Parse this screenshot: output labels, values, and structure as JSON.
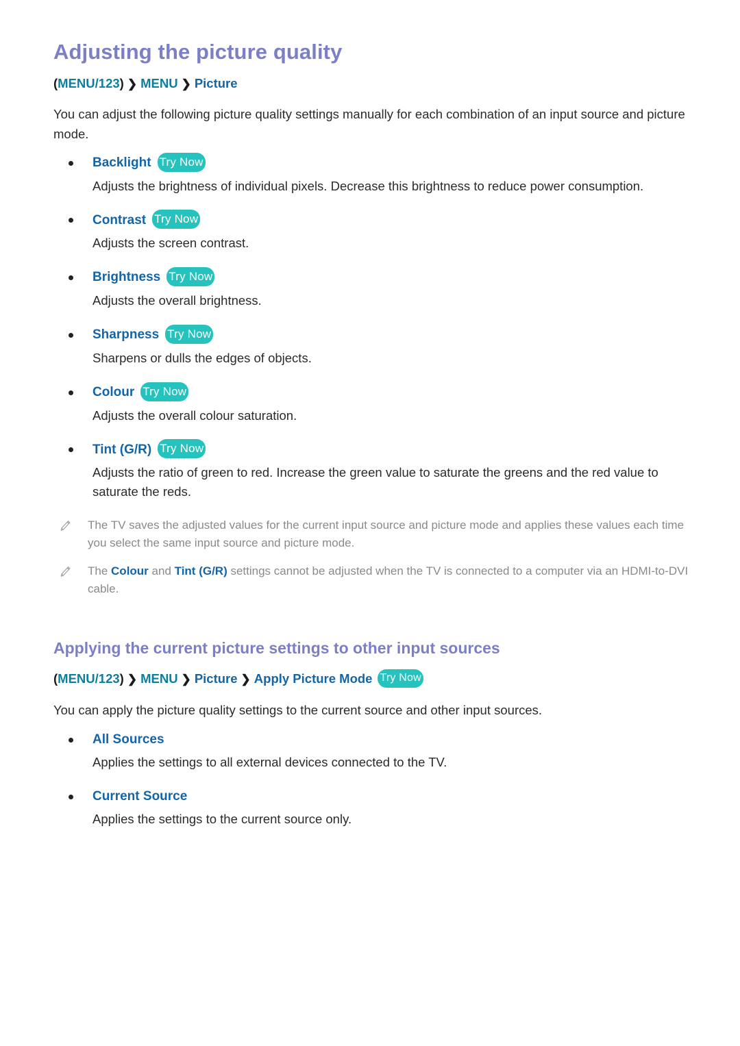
{
  "document": {
    "title": "Adjusting the picture quality",
    "try_now_label": "Try Now"
  },
  "breadcrumb_1": {
    "open_paren": "(",
    "menu123": "MENU/123",
    "close_paren": ")",
    "separator": "❯",
    "menu": "MENU",
    "picture": "Picture"
  },
  "intro_paragraph": "You can adjust the following picture quality settings manually for each combination of an input source and picture mode.",
  "settings": [
    {
      "label": "Backlight",
      "badge": "Try Now",
      "description": "Adjusts the brightness of individual pixels. Decrease this brightness to reduce power consumption."
    },
    {
      "label": "Contrast",
      "badge": "Try Now",
      "description": "Adjusts the screen contrast."
    },
    {
      "label": "Brightness",
      "badge": "Try Now",
      "description": "Adjusts the overall brightness."
    },
    {
      "label": "Sharpness",
      "badge": "Try Now",
      "description": "Sharpens or dulls the edges of objects."
    },
    {
      "label": "Colour",
      "badge": "Try Now",
      "description": "Adjusts the overall colour saturation."
    },
    {
      "label": "Tint (G/R)",
      "badge": "Try Now",
      "description": "Adjusts the ratio of green to red. Increase the green value to saturate the greens and the red value to saturate the reds."
    }
  ],
  "notes": [
    {
      "icon": "pencil-icon",
      "text": "The TV saves the adjusted values for the current input source and picture mode and applies these values each time you select the same input source and picture mode."
    },
    {
      "icon": "pencil-icon",
      "prefix": "The ",
      "highlight_1": "Colour",
      "middle": " and ",
      "highlight_2": "Tint (G/R)",
      "suffix": " settings cannot be adjusted when the TV is connected to a computer via an HDMI-to-DVI cable."
    }
  ],
  "section_2": {
    "title": "Applying the current picture settings to other input sources",
    "breadcrumb": {
      "open_paren": "(",
      "menu123": "MENU/123",
      "close_paren": ")",
      "separator": "❯",
      "menu": "MENU",
      "picture": "Picture",
      "apply_picture_mode": "Apply Picture Mode",
      "badge": "Try Now"
    },
    "intro_paragraph": "You can apply the picture quality settings to the current source and other input sources.",
    "options": [
      {
        "label": "All Sources",
        "description": "Applies the settings to all external devices connected to the TV."
      },
      {
        "label": "Current Source",
        "description": "Applies the settings to the current source only."
      }
    ]
  },
  "colors": {
    "heading": "#7a7fc6",
    "link_blue": "#1464a8",
    "breadcrumb_teal": "#0b7fa0",
    "badge_teal": "#26c2bd",
    "body": "#2b2b2b",
    "note": "#8a8a8a"
  }
}
